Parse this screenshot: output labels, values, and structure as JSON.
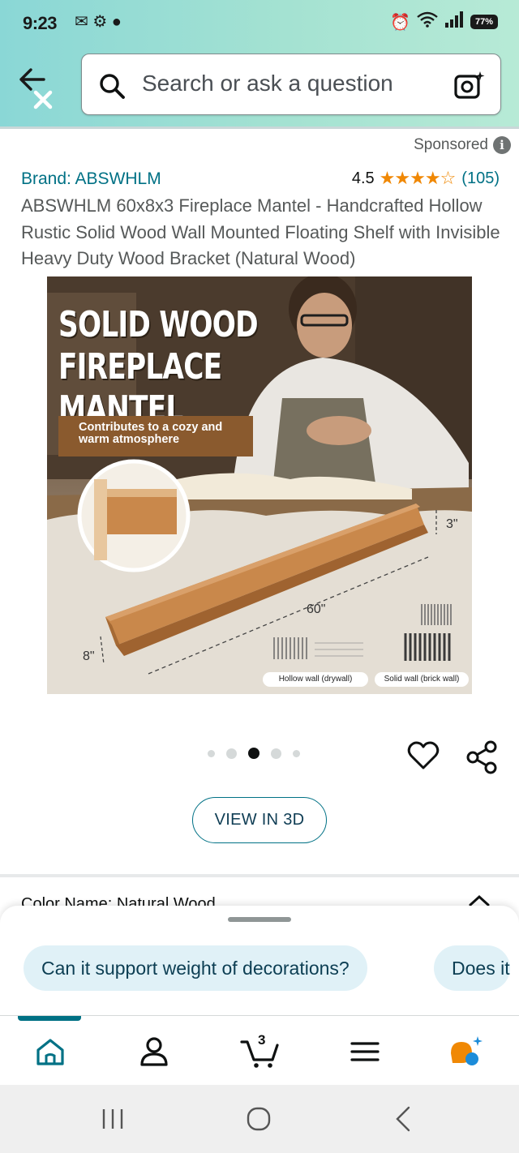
{
  "status_bar": {
    "time": "9:23",
    "battery": "77%"
  },
  "search": {
    "placeholder": "Search or ask a question"
  },
  "product": {
    "sponsored_label": "Sponsored",
    "brand": "Brand: ABSWHLM",
    "rating_value": "4.5",
    "rating_stars": 4.5,
    "review_count": "(105)",
    "title": "ABSWHLM 60x8x3 Fireplace Mantel - Handcrafted Hollow Rustic Solid Wood Wall Mounted Floating Shelf with Invisible Heavy Duty Wood Bracket (Natural Wood)"
  },
  "image": {
    "headline_line1": "SOLID WOOD",
    "headline_line2": "FIREPLACE MANTEL",
    "banner_text": "Contributes to a cozy and warm atmosphere",
    "dim_length": "60\"",
    "dim_height": "3\"",
    "dim_depth": "8\"",
    "caption_hollow": "Hollow wall (drywall)",
    "caption_solid": "Solid wall (brick wall)"
  },
  "carousel": {
    "total": 5,
    "active_index": 2
  },
  "actions": {
    "view_3d_label": "VIEW IN 3D"
  },
  "sheet": {
    "chips": [
      "Can it support weight of decorations?",
      "Does it"
    ]
  },
  "bottom_nav": {
    "cart_count": "3",
    "items": [
      "home-icon",
      "account-icon",
      "cart-icon",
      "menu-icon",
      "rufus-icon"
    ]
  },
  "colors": {
    "link": "#007185",
    "star": "#f08804",
    "header_gradient_start": "#8ad7d6",
    "header_gradient_end": "#b7ead6",
    "chip_bg": "#e0f1f7"
  }
}
